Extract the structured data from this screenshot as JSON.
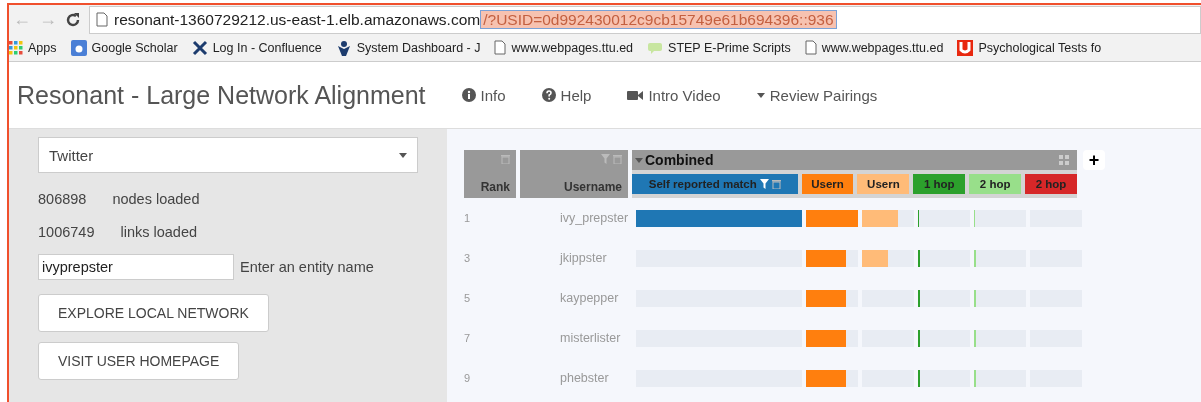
{
  "browser": {
    "back": "←",
    "forward": "→",
    "url_host": "resonant-1360729212.us-east-1.elb.amazonaws.com",
    "url_path": "/?USID=0d992430012c9cb15749e61b694396::936",
    "bookmarks": [
      {
        "label": "Apps",
        "kind": "apps"
      },
      {
        "label": "Google Scholar",
        "kind": "scholar"
      },
      {
        "label": "Log In - Confluence",
        "kind": "confluence"
      },
      {
        "label": "System Dashboard - J",
        "kind": "dashboard"
      },
      {
        "label": "www.webpages.ttu.ed",
        "kind": "page"
      },
      {
        "label": "STEP E-Prime Scripts",
        "kind": "talk"
      },
      {
        "label": "www.webpages.ttu.ed",
        "kind": "page"
      },
      {
        "label": "Psychological Tests fo",
        "kind": "u"
      }
    ]
  },
  "app": {
    "title": "Resonant - Large Network Alignment",
    "nav": [
      {
        "label": "Info",
        "kind": "info"
      },
      {
        "label": "Help",
        "kind": "help"
      },
      {
        "label": "Intro Video",
        "kind": "video"
      },
      {
        "label": "Review Pairings",
        "kind": "dropdown"
      }
    ]
  },
  "sidebar": {
    "dataset": "Twitter",
    "stats": [
      {
        "value": "806898",
        "label": "nodes loaded"
      },
      {
        "value": "1006749",
        "label": "links loaded"
      }
    ],
    "entity": {
      "value": "ivyprepster",
      "label": "Enter an entity name"
    },
    "buttons": [
      "EXPLORE LOCAL NETWORK",
      "VISIT USER HOMEPAGE"
    ]
  },
  "table": {
    "rank_header": "Rank",
    "username_header": "Username",
    "group": "Combined",
    "add_label": "+",
    "columns": [
      {
        "name": "Self reported match",
        "color": "#1f77b4"
      },
      {
        "name": "Usern",
        "color": "#ff7f0e"
      },
      {
        "name": "Usern",
        "color": "#ffbb78"
      },
      {
        "name": "1 hop",
        "color": "#2ca02c"
      },
      {
        "name": "2 hop",
        "color": "#98df8a"
      },
      {
        "name": "2 hop",
        "color": "#d62728"
      }
    ],
    "rows": [
      {
        "rank": "1",
        "username": "ivy_prepster",
        "bars": [
          {
            "level": 1
          },
          {
            "level": 1
          },
          {
            "level": 0.7
          },
          {
            "level": 0.02
          },
          {
            "level": 0.02
          },
          {
            "level": 0
          }
        ]
      },
      {
        "rank": "3",
        "username": "jkippster",
        "bars": [
          {
            "level": 0
          },
          {
            "level": 0.77
          },
          {
            "level": 0.5
          },
          {
            "level": 0.04
          },
          {
            "level": 0.04
          },
          {
            "level": 0
          }
        ]
      },
      {
        "rank": "5",
        "username": "kaypepper",
        "bars": [
          {
            "level": 0
          },
          {
            "level": 0.77
          },
          {
            "level": 0
          },
          {
            "level": 0.04
          },
          {
            "level": 0.04
          },
          {
            "level": 0
          }
        ]
      },
      {
        "rank": "7",
        "username": "misterlister",
        "bars": [
          {
            "level": 0
          },
          {
            "level": 0.77
          },
          {
            "level": 0
          },
          {
            "level": 0.04
          },
          {
            "level": 0.04
          },
          {
            "level": 0
          }
        ]
      },
      {
        "rank": "9",
        "username": "phebster",
        "bars": [
          {
            "level": 0
          },
          {
            "level": 0.77
          },
          {
            "level": 0
          },
          {
            "level": 0.04
          },
          {
            "level": 0.04
          },
          {
            "level": 0
          }
        ]
      }
    ]
  }
}
